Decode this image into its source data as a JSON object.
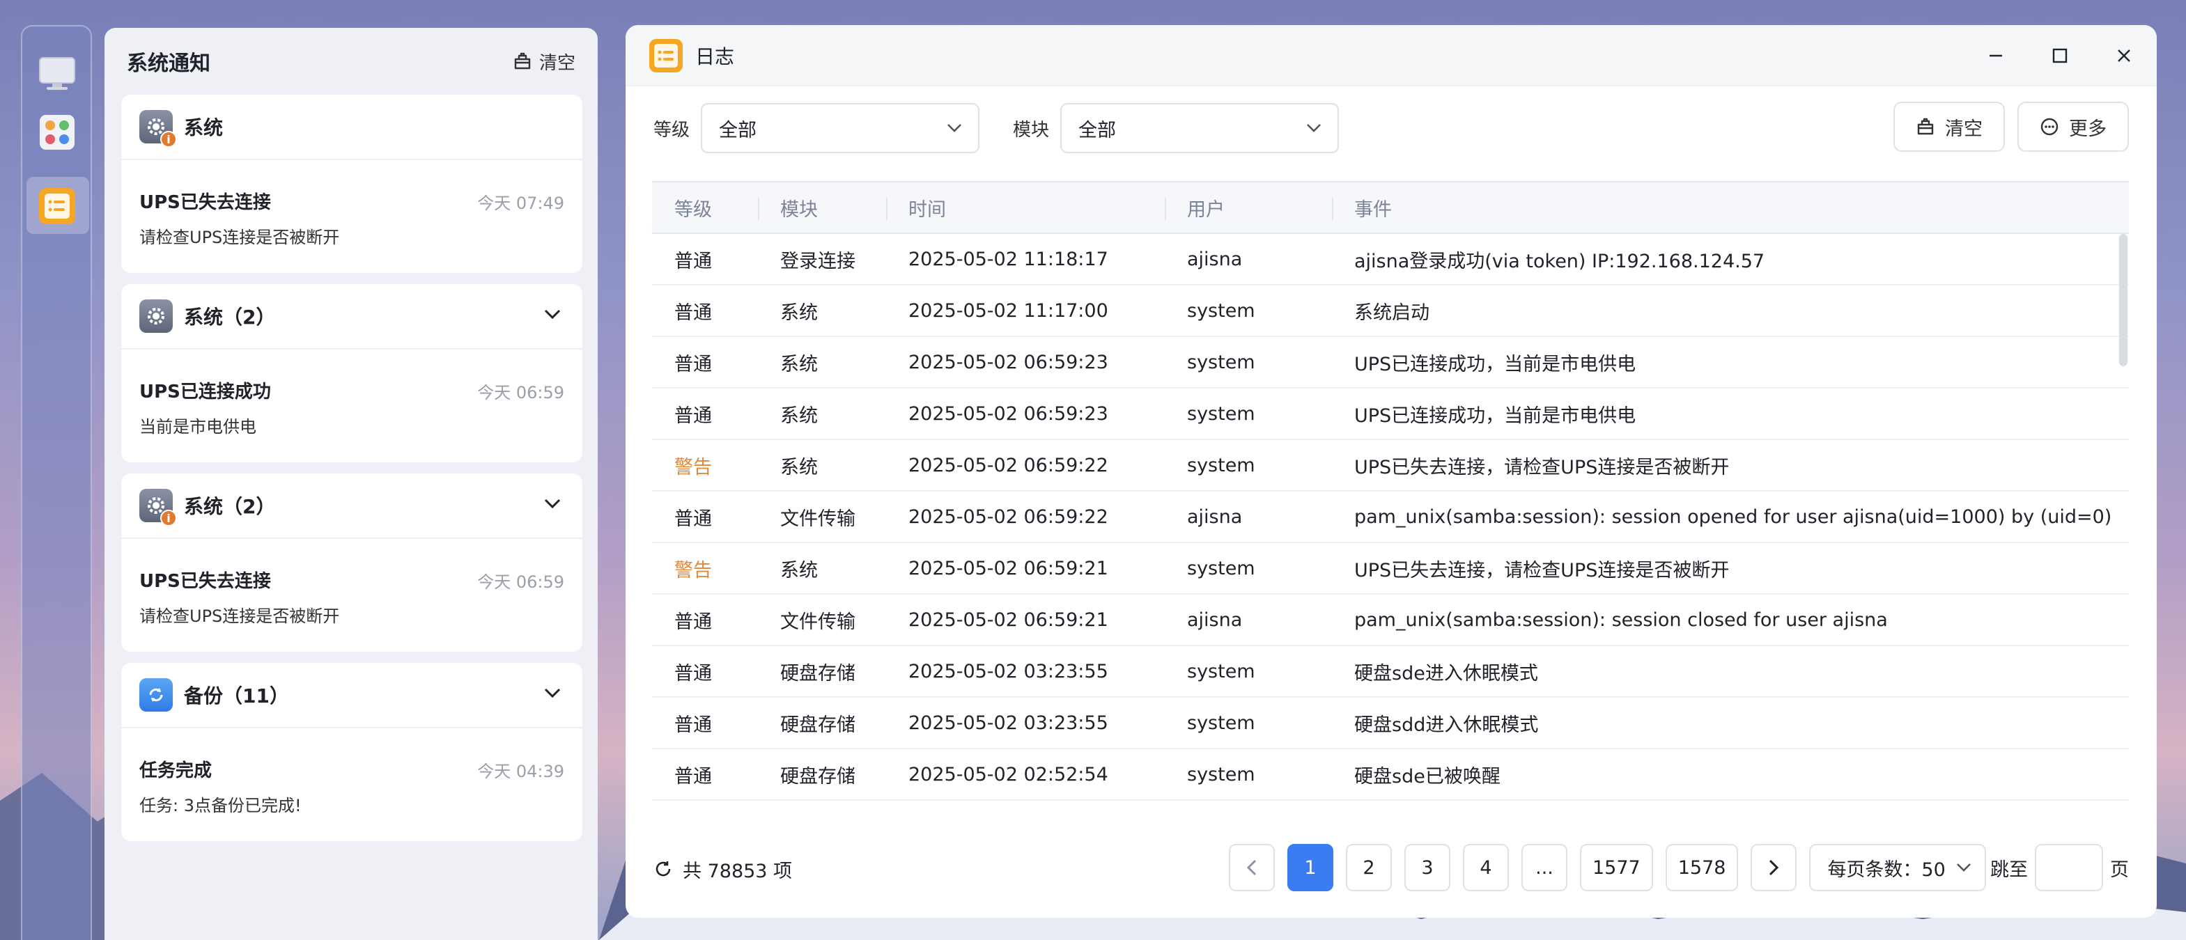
{
  "notifications": {
    "title": "系统通知",
    "clear_label": "清空",
    "cards": [
      {
        "app": "系统",
        "msg_title": "UPS已失去连接",
        "time": "今天 07:49",
        "msg_sub": "请检查UPS连接是否被断开"
      },
      {
        "app": "系统（2）",
        "msg_title": "UPS已连接成功",
        "time": "今天 06:59",
        "msg_sub": "当前是市电供电"
      },
      {
        "app": "系统（2）",
        "msg_title": "UPS已失去连接",
        "time": "今天 06:59",
        "msg_sub": "请检查UPS连接是否被断开"
      },
      {
        "app": "备份（11）",
        "msg_title": "任务完成",
        "time": "今天 04:39",
        "msg_sub": "任务: 3点备份已完成!"
      }
    ]
  },
  "window": {
    "title": "日志"
  },
  "filters": {
    "level_label": "等级",
    "level_value": "全部",
    "module_label": "模块",
    "module_value": "全部",
    "clear_label": "清空",
    "more_label": "更多"
  },
  "table": {
    "headers": [
      "等级",
      "模块",
      "时间",
      "用户",
      "事件"
    ],
    "rows": [
      [
        "普通",
        "登录连接",
        "2025-05-02 11:18:17",
        "ajisna",
        "ajisna登录成功(via token) IP:192.168.124.57"
      ],
      [
        "普通",
        "系统",
        "2025-05-02 11:17:00",
        "system",
        "系统启动"
      ],
      [
        "普通",
        "系统",
        "2025-05-02 06:59:23",
        "system",
        "UPS已连接成功，当前是市电供电"
      ],
      [
        "普通",
        "系统",
        "2025-05-02 06:59:23",
        "system",
        "UPS已连接成功，当前是市电供电"
      ],
      [
        "警告",
        "系统",
        "2025-05-02 06:59:22",
        "system",
        "UPS已失去连接，请检查UPS连接是否被断开"
      ],
      [
        "普通",
        "文件传输",
        "2025-05-02 06:59:22",
        "ajisna",
        "pam_unix(samba:session): session opened for user ajisna(uid=1000) by (uid=0)"
      ],
      [
        "警告",
        "系统",
        "2025-05-02 06:59:21",
        "system",
        "UPS已失去连接，请检查UPS连接是否被断开"
      ],
      [
        "普通",
        "文件传输",
        "2025-05-02 06:59:21",
        "ajisna",
        "pam_unix(samba:session): session closed for user ajisna"
      ],
      [
        "普通",
        "硬盘存储",
        "2025-05-02 03:23:55",
        "system",
        "硬盘sde进入休眠模式"
      ],
      [
        "普通",
        "硬盘存储",
        "2025-05-02 03:23:55",
        "system",
        "硬盘sdd进入休眠模式"
      ],
      [
        "普通",
        "硬盘存储",
        "2025-05-02 02:52:54",
        "system",
        "硬盘sde已被唤醒"
      ]
    ]
  },
  "pager": {
    "total": "共 78853 项",
    "pages": [
      "1",
      "2",
      "3",
      "4",
      "...",
      "1577",
      "1578"
    ],
    "per_page": "每页条数：50",
    "jump_label": "跳至",
    "page_suffix": "页"
  },
  "colors": {
    "accent": "#3b7cf0",
    "warning": "#e08a3c"
  }
}
